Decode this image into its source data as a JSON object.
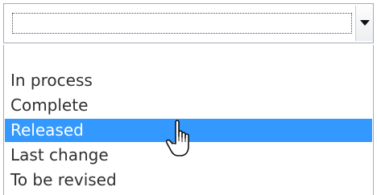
{
  "dropdown": {
    "current_value": "",
    "options": [
      {
        "label": ""
      },
      {
        "label": "In process"
      },
      {
        "label": "Complete"
      },
      {
        "label": "Released"
      },
      {
        "label": "Last change"
      },
      {
        "label": "To be revised"
      }
    ],
    "selected_option": "Released"
  },
  "icons": {
    "dropdown_button": "chevron-down-icon",
    "pointer": "hand-pointer-icon"
  },
  "colors": {
    "selection_background": "#3399ff",
    "selection_text": "#ffffff",
    "item_text": "#303030",
    "border": "#a5acb5"
  }
}
